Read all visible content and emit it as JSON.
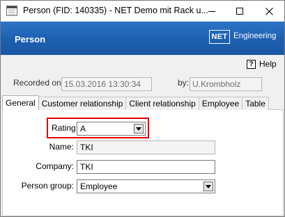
{
  "window": {
    "title": "Person (FID: 140335) - NET Demo mit Rack u...",
    "min_icon": "minimize-icon",
    "max_icon": "maximize-icon",
    "close_icon": "close-icon"
  },
  "banner": {
    "title": "Person",
    "logo_text": "NET",
    "logo_word": "Engineering",
    "color": "#1f63b5"
  },
  "help": {
    "label": "Help",
    "icon": "help-icon"
  },
  "record": {
    "recorded_on_label": "Recorded on:",
    "recorded_on_value": "15.03.2016 13:30:34",
    "by_label": "by:",
    "by_value": "U.Krombholz"
  },
  "tabs": [
    {
      "label": "General",
      "active": true
    },
    {
      "label": "Customer relationship",
      "active": false
    },
    {
      "label": "Client relationship",
      "active": false
    },
    {
      "label": "Employee",
      "active": false
    },
    {
      "label": "Table",
      "active": false
    }
  ],
  "form": {
    "rating_label": "Rating:",
    "rating_value": "A",
    "name_label": "Name:",
    "name_value": "TKI",
    "company_label": "Company:",
    "company_value": "TKI",
    "person_group_label": "Person group:",
    "person_group_value": "Employee"
  },
  "highlight_color": "#e00000"
}
